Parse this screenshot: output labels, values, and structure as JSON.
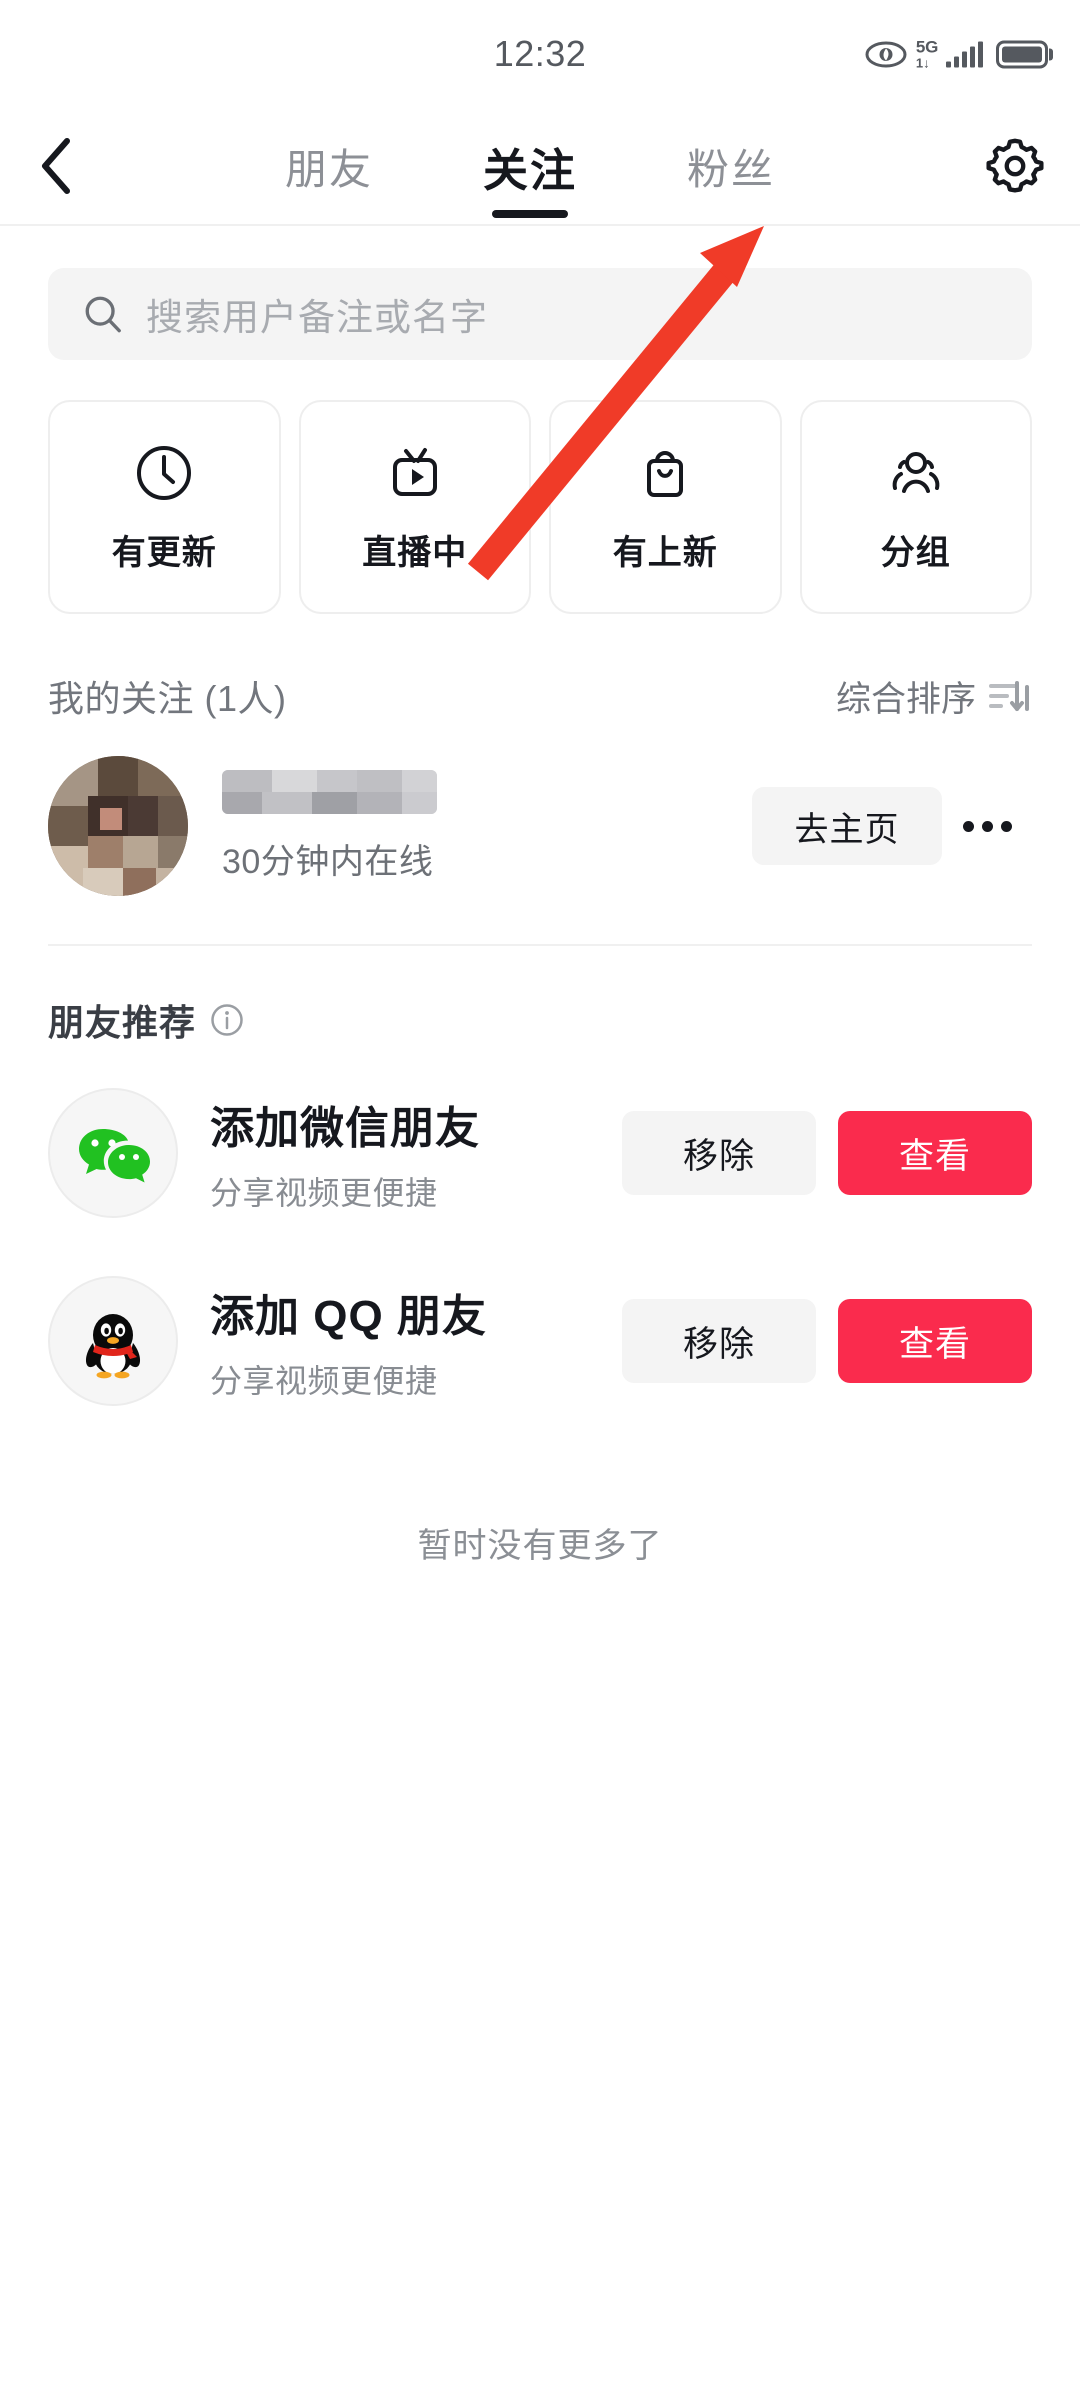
{
  "status_bar": {
    "time": "12:32",
    "eye_icon": "eye-icon",
    "network_label": "5G",
    "network_sub_label": "1↓",
    "signal_icon": "signal-bars-icon",
    "battery_icon": "battery-icon"
  },
  "top_nav": {
    "back_icon": "back-chevron-icon",
    "settings_icon": "gear-icon",
    "tabs": [
      {
        "label": "朋友",
        "active": false
      },
      {
        "label": "关注",
        "active": true
      },
      {
        "label": "粉丝",
        "active": false
      }
    ]
  },
  "search": {
    "icon": "search-icon",
    "placeholder": "搜索用户备注或名字",
    "value": ""
  },
  "quick_actions": [
    {
      "label": "有更新",
      "icon": "clock-icon"
    },
    {
      "label": "直播中",
      "icon": "live-tv-icon"
    },
    {
      "label": "有上新",
      "icon": "shopping-bag-icon"
    },
    {
      "label": "分组",
      "icon": "people-group-icon"
    }
  ],
  "following_section": {
    "title": "我的关注 (1人)",
    "sort_label": "综合排序",
    "sort_icon": "sort-icon",
    "items": [
      {
        "name": "",
        "name_masked": true,
        "status": "30分钟内在线",
        "action_label": "去主页",
        "more_icon": "more-dots-icon"
      }
    ]
  },
  "recommend_section": {
    "title": "朋友推荐",
    "info_icon": "info-circle-icon",
    "items": [
      {
        "icon": "wechat-icon",
        "name": "添加微信朋友",
        "subtitle": "分享视频更便捷",
        "remove_label": "移除",
        "view_label": "查看"
      },
      {
        "icon": "qq-penguin-icon",
        "name": "添加 QQ 朋友",
        "subtitle": "分享视频更便捷",
        "remove_label": "移除",
        "view_label": "查看"
      }
    ]
  },
  "footer": {
    "note": "暂时没有更多了"
  },
  "annotation": {
    "arrow_icon": "red-arrow-annotation",
    "color": "#F03B28",
    "points_to": "粉丝"
  },
  "colors": {
    "accent_red": "#FA2B4D",
    "text_primary": "#16181E",
    "text_secondary": "#72767D",
    "surface_gray": "#F4F4F4",
    "wechat_green": "#21C121"
  }
}
